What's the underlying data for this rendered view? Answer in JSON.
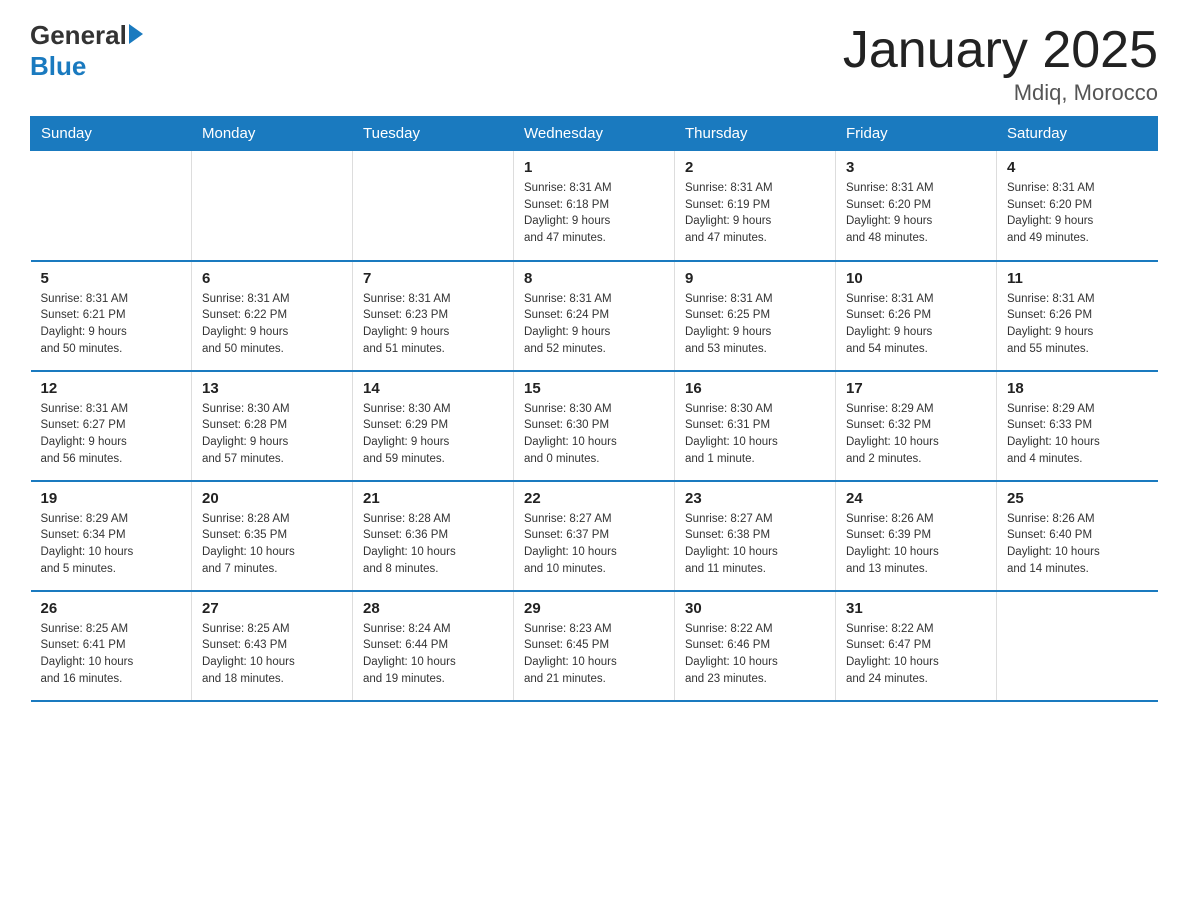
{
  "header": {
    "logo_general": "General",
    "logo_blue": "Blue",
    "title": "January 2025",
    "subtitle": "Mdiq, Morocco"
  },
  "days_of_week": [
    "Sunday",
    "Monday",
    "Tuesday",
    "Wednesday",
    "Thursday",
    "Friday",
    "Saturday"
  ],
  "weeks": [
    [
      {
        "day": "",
        "info": ""
      },
      {
        "day": "",
        "info": ""
      },
      {
        "day": "",
        "info": ""
      },
      {
        "day": "1",
        "info": "Sunrise: 8:31 AM\nSunset: 6:18 PM\nDaylight: 9 hours\nand 47 minutes."
      },
      {
        "day": "2",
        "info": "Sunrise: 8:31 AM\nSunset: 6:19 PM\nDaylight: 9 hours\nand 47 minutes."
      },
      {
        "day": "3",
        "info": "Sunrise: 8:31 AM\nSunset: 6:20 PM\nDaylight: 9 hours\nand 48 minutes."
      },
      {
        "day": "4",
        "info": "Sunrise: 8:31 AM\nSunset: 6:20 PM\nDaylight: 9 hours\nand 49 minutes."
      }
    ],
    [
      {
        "day": "5",
        "info": "Sunrise: 8:31 AM\nSunset: 6:21 PM\nDaylight: 9 hours\nand 50 minutes."
      },
      {
        "day": "6",
        "info": "Sunrise: 8:31 AM\nSunset: 6:22 PM\nDaylight: 9 hours\nand 50 minutes."
      },
      {
        "day": "7",
        "info": "Sunrise: 8:31 AM\nSunset: 6:23 PM\nDaylight: 9 hours\nand 51 minutes."
      },
      {
        "day": "8",
        "info": "Sunrise: 8:31 AM\nSunset: 6:24 PM\nDaylight: 9 hours\nand 52 minutes."
      },
      {
        "day": "9",
        "info": "Sunrise: 8:31 AM\nSunset: 6:25 PM\nDaylight: 9 hours\nand 53 minutes."
      },
      {
        "day": "10",
        "info": "Sunrise: 8:31 AM\nSunset: 6:26 PM\nDaylight: 9 hours\nand 54 minutes."
      },
      {
        "day": "11",
        "info": "Sunrise: 8:31 AM\nSunset: 6:26 PM\nDaylight: 9 hours\nand 55 minutes."
      }
    ],
    [
      {
        "day": "12",
        "info": "Sunrise: 8:31 AM\nSunset: 6:27 PM\nDaylight: 9 hours\nand 56 minutes."
      },
      {
        "day": "13",
        "info": "Sunrise: 8:30 AM\nSunset: 6:28 PM\nDaylight: 9 hours\nand 57 minutes."
      },
      {
        "day": "14",
        "info": "Sunrise: 8:30 AM\nSunset: 6:29 PM\nDaylight: 9 hours\nand 59 minutes."
      },
      {
        "day": "15",
        "info": "Sunrise: 8:30 AM\nSunset: 6:30 PM\nDaylight: 10 hours\nand 0 minutes."
      },
      {
        "day": "16",
        "info": "Sunrise: 8:30 AM\nSunset: 6:31 PM\nDaylight: 10 hours\nand 1 minute."
      },
      {
        "day": "17",
        "info": "Sunrise: 8:29 AM\nSunset: 6:32 PM\nDaylight: 10 hours\nand 2 minutes."
      },
      {
        "day": "18",
        "info": "Sunrise: 8:29 AM\nSunset: 6:33 PM\nDaylight: 10 hours\nand 4 minutes."
      }
    ],
    [
      {
        "day": "19",
        "info": "Sunrise: 8:29 AM\nSunset: 6:34 PM\nDaylight: 10 hours\nand 5 minutes."
      },
      {
        "day": "20",
        "info": "Sunrise: 8:28 AM\nSunset: 6:35 PM\nDaylight: 10 hours\nand 7 minutes."
      },
      {
        "day": "21",
        "info": "Sunrise: 8:28 AM\nSunset: 6:36 PM\nDaylight: 10 hours\nand 8 minutes."
      },
      {
        "day": "22",
        "info": "Sunrise: 8:27 AM\nSunset: 6:37 PM\nDaylight: 10 hours\nand 10 minutes."
      },
      {
        "day": "23",
        "info": "Sunrise: 8:27 AM\nSunset: 6:38 PM\nDaylight: 10 hours\nand 11 minutes."
      },
      {
        "day": "24",
        "info": "Sunrise: 8:26 AM\nSunset: 6:39 PM\nDaylight: 10 hours\nand 13 minutes."
      },
      {
        "day": "25",
        "info": "Sunrise: 8:26 AM\nSunset: 6:40 PM\nDaylight: 10 hours\nand 14 minutes."
      }
    ],
    [
      {
        "day": "26",
        "info": "Sunrise: 8:25 AM\nSunset: 6:41 PM\nDaylight: 10 hours\nand 16 minutes."
      },
      {
        "day": "27",
        "info": "Sunrise: 8:25 AM\nSunset: 6:43 PM\nDaylight: 10 hours\nand 18 minutes."
      },
      {
        "day": "28",
        "info": "Sunrise: 8:24 AM\nSunset: 6:44 PM\nDaylight: 10 hours\nand 19 minutes."
      },
      {
        "day": "29",
        "info": "Sunrise: 8:23 AM\nSunset: 6:45 PM\nDaylight: 10 hours\nand 21 minutes."
      },
      {
        "day": "30",
        "info": "Sunrise: 8:22 AM\nSunset: 6:46 PM\nDaylight: 10 hours\nand 23 minutes."
      },
      {
        "day": "31",
        "info": "Sunrise: 8:22 AM\nSunset: 6:47 PM\nDaylight: 10 hours\nand 24 minutes."
      },
      {
        "day": "",
        "info": ""
      }
    ]
  ]
}
